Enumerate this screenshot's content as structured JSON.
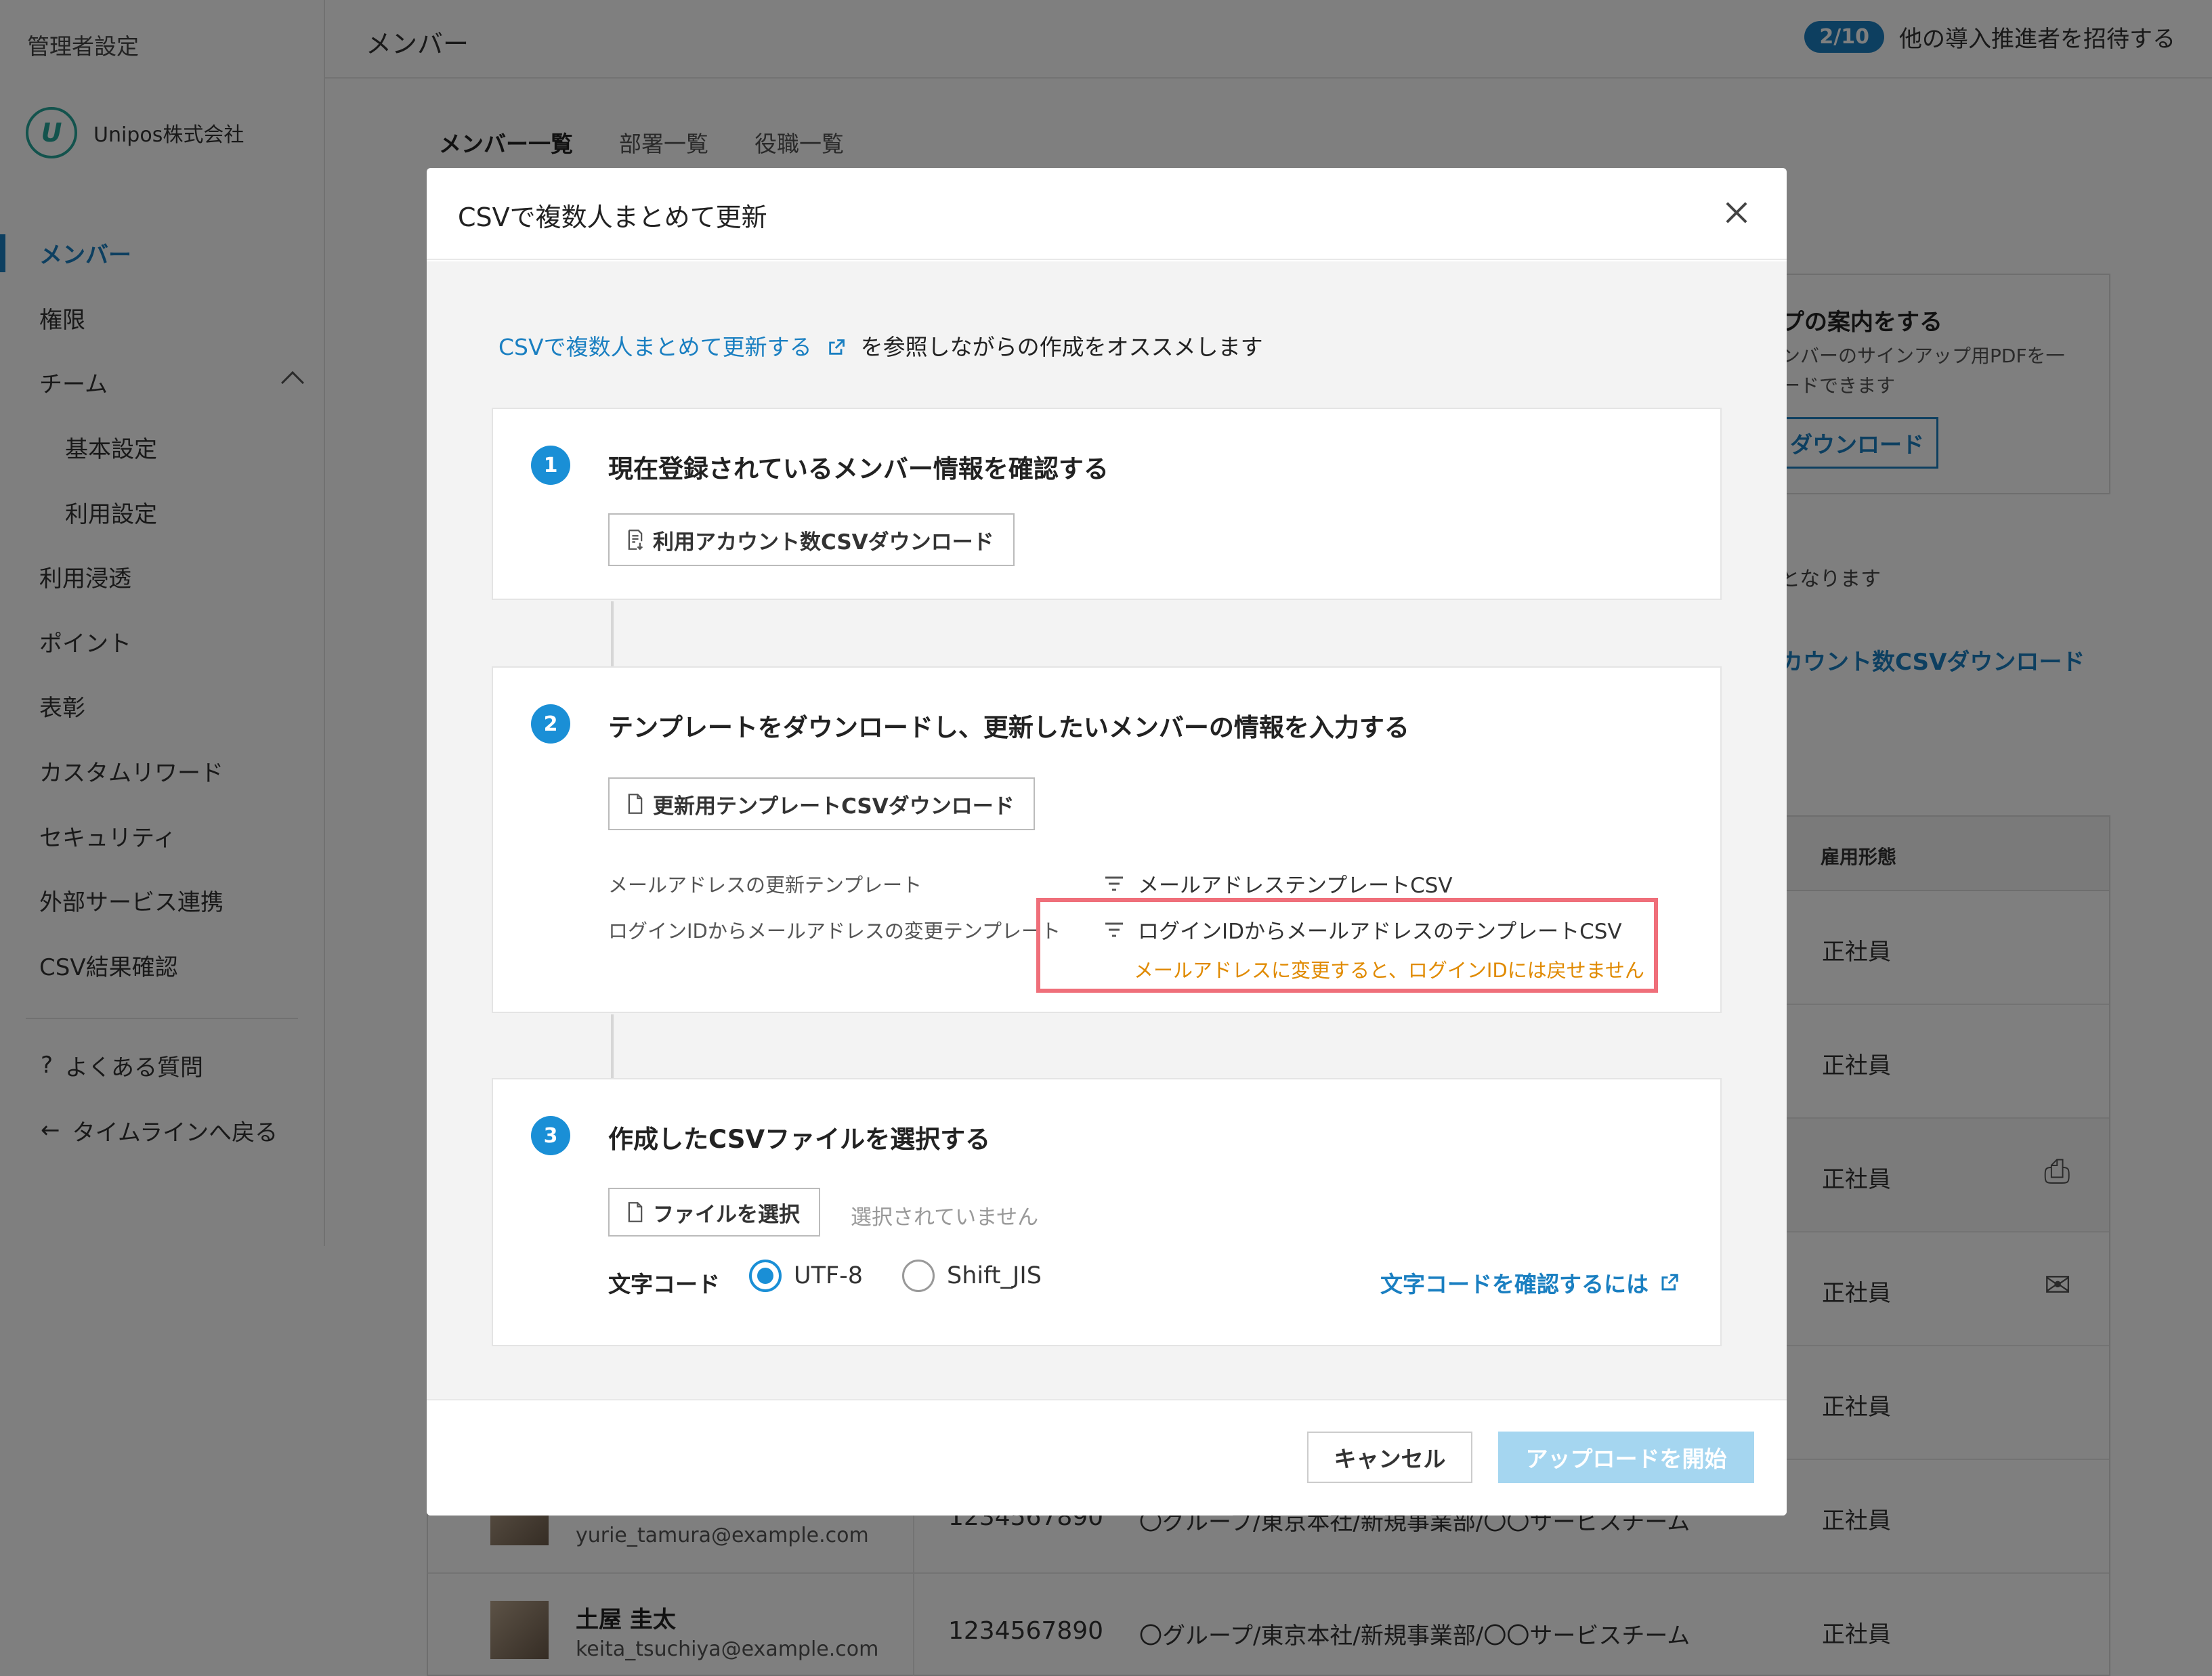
{
  "sidebar": {
    "title": "管理者設定",
    "company": "Unipos株式会社",
    "items": [
      {
        "label": "メンバー"
      },
      {
        "label": "権限"
      },
      {
        "label": "チーム"
      },
      {
        "label": "基本設定"
      },
      {
        "label": "利用設定"
      },
      {
        "label": "利用浸透"
      },
      {
        "label": "ポイント"
      },
      {
        "label": "表彰"
      },
      {
        "label": "カスタムリワード"
      },
      {
        "label": "セキュリティ"
      },
      {
        "label": "外部サービス連携"
      },
      {
        "label": "CSV結果確認"
      }
    ],
    "footer": [
      {
        "icon": "?",
        "label": "よくある質問"
      },
      {
        "icon": "←",
        "label": "タイムラインへ戻る"
      }
    ]
  },
  "header": {
    "title": "メンバー",
    "invite_count": "2/10",
    "invite_label": "他の導入推進者を招待する"
  },
  "tabs": [
    "メンバー一覧",
    "部署一覧",
    "役職一覧"
  ],
  "background": {
    "card_title": "プの案内をする",
    "card_text_1": "ンバーのサインアップ用PDFを一",
    "card_text_2": "ードできます",
    "card_button": "ダウンロード",
    "note": "となります",
    "link": "カウント数CSVダウンロード",
    "table_header": "雇用形態",
    "employment": [
      "正社員",
      "正社員",
      "正社員",
      "正社員",
      "正社員",
      "正社員",
      "正社員"
    ],
    "rows": [
      {
        "name": "",
        "email": "yurie_tamura@example.com",
        "number": "1234567890",
        "group": "〇グループ/東京本社/新規事業部/〇〇サービスチーム"
      },
      {
        "name": "土屋 圭太",
        "email": "keita_tsuchiya@example.com",
        "number": "1234567890",
        "group": "〇グループ/東京本社/新規事業部/〇〇サービスチーム"
      }
    ]
  },
  "modal": {
    "title": "CSVで複数人まとめて更新",
    "intro_link": "CSVで複数人まとめて更新する",
    "intro_text": "を参照しながらの作成をオススメします",
    "step1": {
      "num": "1",
      "title": "現在登録されているメンバー情報を確認する",
      "button": "利用アカウント数CSVダウンロード"
    },
    "step2": {
      "num": "2",
      "title": "テンプレートをダウンロードし、更新したいメンバーの情報を入力する",
      "button": "更新用テンプレートCSVダウンロード",
      "row1_label": "メールアドレスの更新テンプレート",
      "row1_link": "メールアドレステンプレートCSV",
      "row2_label": "ログインIDからメールアドレスの変更テンプレート",
      "row2_link": "ログインIDからメールアドレスのテンプレートCSV",
      "warning": "メールアドレスに変更すると、ログインIDには戻せません"
    },
    "step3": {
      "num": "3",
      "title": "作成したCSVファイルを選択する",
      "button": "ファイルを選択",
      "no_file": "選択されていません",
      "encoding_label": "文字コード",
      "option_utf8": "UTF-8",
      "option_sjis": "Shift_JIS",
      "encoding_link": "文字コードを確認するには"
    },
    "cancel": "キャンセル",
    "upload": "アップロードを開始"
  },
  "colors": {
    "accent": "#1a8fd6",
    "link": "#1a7fc1",
    "warning_text": "#e08a00",
    "highlight_border": "#ef6f7a",
    "upload_disabled": "#a5d6f0"
  }
}
